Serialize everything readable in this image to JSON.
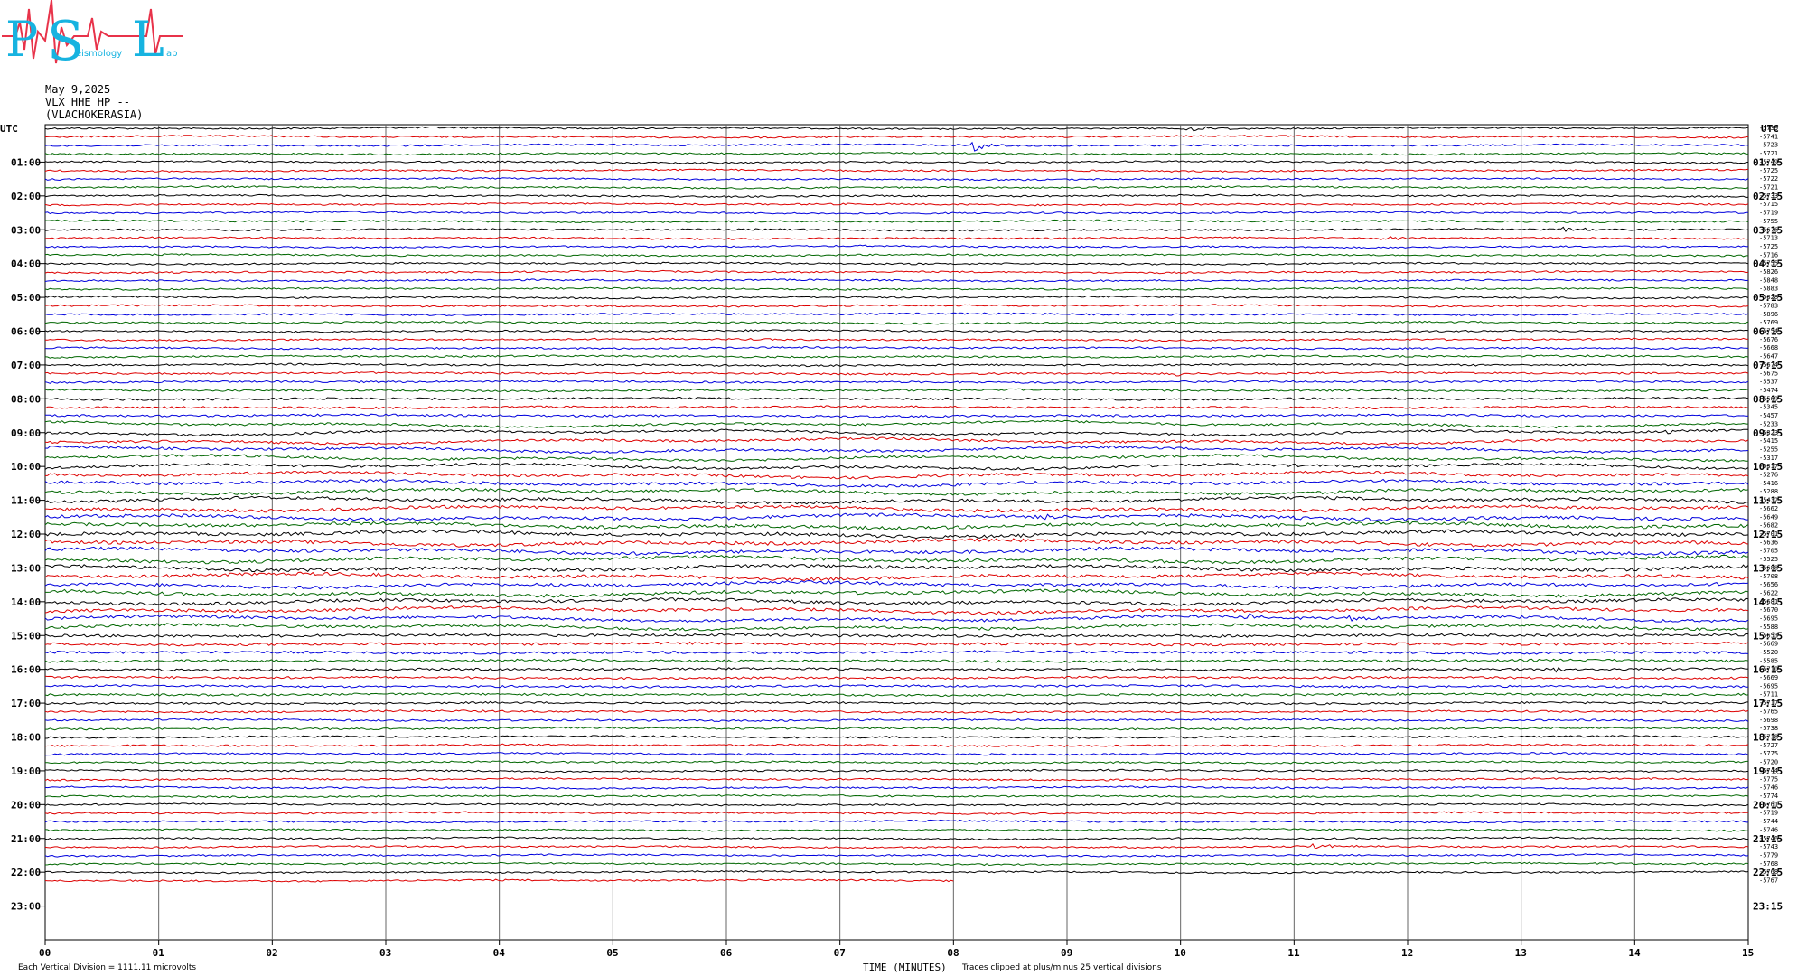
{
  "logo": {
    "text_big_1": "P",
    "text_big_2": "S",
    "text_big_3": "L",
    "text_small_1": "eismology",
    "text_small_2": "ab"
  },
  "header": {
    "date": "May 9,2025",
    "channel": "VLX HHE HP --",
    "station": "(VLACHOKERASIA)"
  },
  "chart_data": {
    "type": "line",
    "left_axis_title": "UTC",
    "right_axis_title": "UTC",
    "left_hour_labels": [
      "01:00",
      "02:00",
      "03:00",
      "04:00",
      "05:00",
      "06:00",
      "07:00",
      "08:00",
      "09:00",
      "10:00",
      "11:00",
      "12:00",
      "13:00",
      "14:00",
      "15:00",
      "16:00",
      "17:00",
      "18:00",
      "19:00",
      "20:00",
      "21:00",
      "22:00",
      "23:00"
    ],
    "right_hour_labels": [
      "01:15",
      "02:15",
      "03:15",
      "04:15",
      "05:15",
      "06:15",
      "07:15",
      "08:15",
      "09:15",
      "10:15",
      "11:15",
      "12:15",
      "13:15",
      "14:15",
      "15:15",
      "16:15",
      "17:15",
      "18:15",
      "19:15",
      "20:15",
      "21:15",
      "22:15",
      "23:15"
    ],
    "x_tick_labels": [
      "00",
      "01",
      "02",
      "03",
      "04",
      "05",
      "06",
      "07",
      "08",
      "09",
      "10",
      "11",
      "12",
      "13",
      "14",
      "15"
    ],
    "xlabel": "TIME (MINUTES)",
    "xlim": [
      0,
      15
    ],
    "trace_colors": [
      "#000000",
      "#dd0000",
      "#0000dd",
      "#006600"
    ],
    "trace_offsets": [
      "-5739",
      "-5741",
      "-5723",
      "-5721",
      "-5749",
      "-5725",
      "-5722",
      "-5721",
      "-5733",
      "-5715",
      "-5719",
      "-5755",
      "-5676",
      "-5713",
      "-5725",
      "-5716",
      "-5755",
      "-5826",
      "-5848",
      "-5883",
      "-5828",
      "-5783",
      "-5896",
      "-5769",
      "-5754",
      "-5676",
      "-5668",
      "-5647",
      "-5674",
      "-5675",
      "-5537",
      "-5474",
      "-5569",
      "-5345",
      "-5457",
      "-5233",
      "-5323",
      "-5415",
      "-5255",
      "-5317",
      "-5317",
      "-5276",
      "-5416",
      "-5288",
      "-5432",
      "-5662",
      "-5649",
      "-5682",
      "-5701",
      "-5636",
      "-5705",
      "-5525",
      "-5688",
      "-5708",
      "-5656",
      "-5622",
      "-5681",
      "-5670",
      "-5695",
      "-5588",
      "-5653",
      "-5669",
      "-5520",
      "-5585",
      "-5710",
      "-5669",
      "-5695",
      "-5711",
      "-5717",
      "-5765",
      "-5698",
      "-5738",
      "-5718",
      "-5727",
      "-5775",
      "-5720",
      "-5744",
      "-5775",
      "-5746",
      "-5774",
      "-5761",
      "-5719",
      "-5744",
      "-5746",
      "-5746",
      "-5743",
      "-5779",
      "-5768",
      "-5768",
      "-5767"
    ],
    "total_traces_rows": 96,
    "traces_plotted": 90,
    "last_trace_end_minute": 8.0,
    "notable_events": [
      {
        "trace": 0,
        "minute": 10.1,
        "amp": 4
      },
      {
        "trace": 2,
        "minute": 8.2,
        "amp": 7
      },
      {
        "trace": 12,
        "minute": 13.4,
        "amp": 3
      },
      {
        "trace": 13,
        "minute": 11.8,
        "amp": 3
      },
      {
        "trace": 29,
        "minute": 10.0,
        "amp": 3
      },
      {
        "trace": 36,
        "minute": 14.3,
        "amp": 3
      },
      {
        "trace": 42,
        "minute": 9.8,
        "amp": 3
      },
      {
        "trace": 46,
        "minute": 8.8,
        "amp": 4
      },
      {
        "trace": 58,
        "minute": 10.6,
        "amp": 4
      },
      {
        "trace": 58,
        "minute": 11.5,
        "amp": 4
      },
      {
        "trace": 64,
        "minute": 13.3,
        "amp": 3
      },
      {
        "trace": 85,
        "minute": 11.2,
        "amp": 3
      }
    ]
  },
  "footer": {
    "scale_note": "Each Vertical Division = 1111.11 microvolts",
    "xlabel": "TIME (MINUTES)",
    "clip_note": "Traces clipped at plus/minus 25 vertical divisions"
  }
}
